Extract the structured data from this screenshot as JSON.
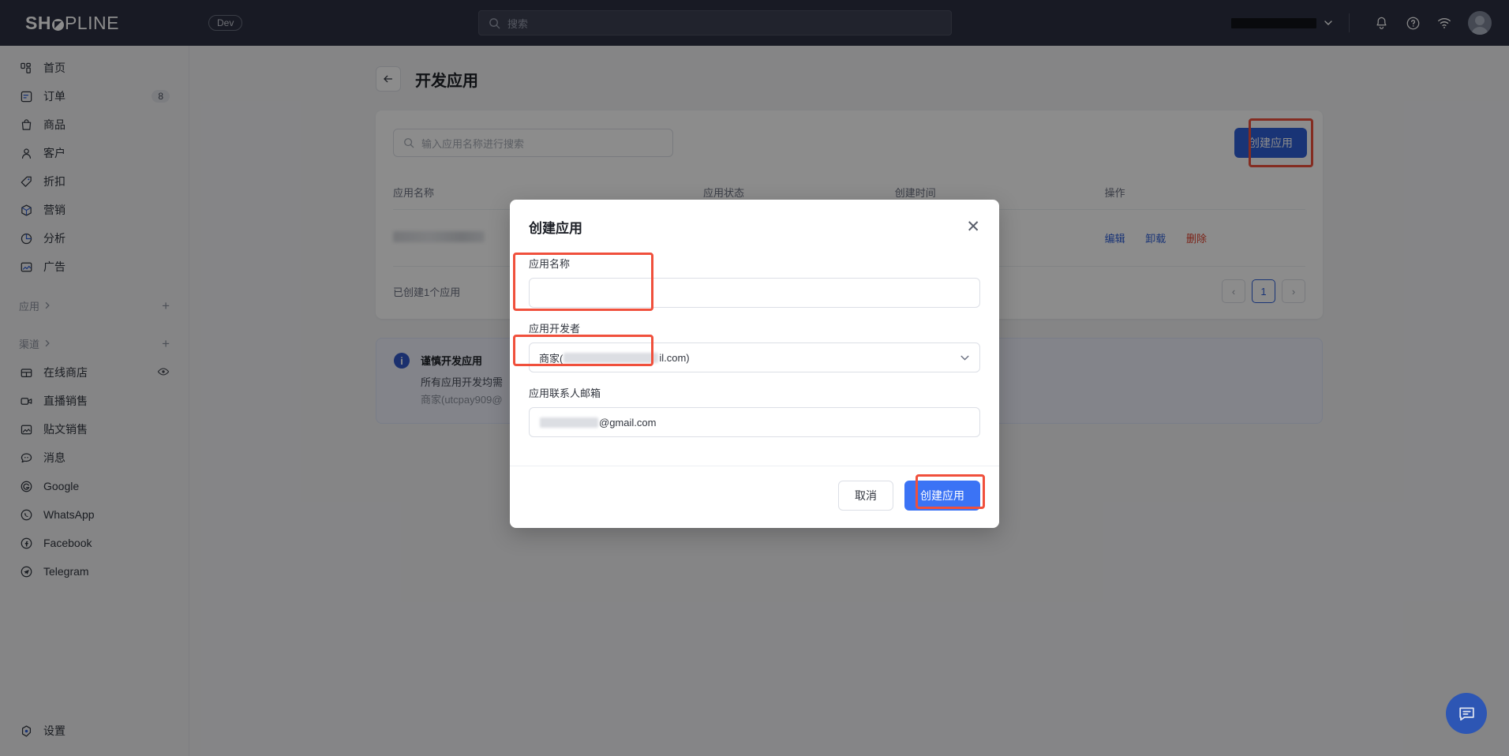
{
  "brand": {
    "name_bold": "SH",
    "name_thin": "PLINE",
    "accent": "#2f5fd8",
    "danger": "#e0412d"
  },
  "topbar": {
    "env_badge": "Dev",
    "search_placeholder": "搜索",
    "store_name": "",
    "icons": {
      "bell": "bell-icon",
      "help": "help-icon",
      "wifi": "wifi-icon",
      "avatar": "avatar"
    }
  },
  "sidebar": {
    "items": [
      {
        "label": "首页",
        "badge": ""
      },
      {
        "label": "订单",
        "badge": "8"
      },
      {
        "label": "商品",
        "badge": ""
      },
      {
        "label": "客户",
        "badge": ""
      },
      {
        "label": "折扣",
        "badge": ""
      },
      {
        "label": "营销",
        "badge": ""
      },
      {
        "label": "分析",
        "badge": ""
      },
      {
        "label": "广告",
        "badge": ""
      }
    ],
    "group_apps": "应用",
    "group_channels": "渠道",
    "channels": [
      {
        "label": "在线商店"
      },
      {
        "label": "直播销售"
      },
      {
        "label": "贴文销售"
      },
      {
        "label": "消息"
      },
      {
        "label": "Google"
      },
      {
        "label": "WhatsApp"
      },
      {
        "label": "Facebook"
      },
      {
        "label": "Telegram"
      }
    ],
    "settings": "设置"
  },
  "page": {
    "title": "开发应用",
    "search_placeholder": "输入应用名称进行搜索",
    "create_button": "创建应用",
    "table": {
      "columns": [
        "应用名称",
        "应用状态",
        "创建时间",
        "操作"
      ],
      "rows": [
        {
          "name": "",
          "status": "",
          "created": "",
          "actions": [
            "编辑",
            "卸载",
            "删除"
          ]
        }
      ]
    },
    "footer_count": "已创建1个应用",
    "pagination": {
      "prev": "‹",
      "current": "1",
      "next": "›"
    }
  },
  "notice": {
    "title": "谨慎开发应用",
    "line1": "所有应用开发均需",
    "line2": "商家(utcpay909@"
  },
  "modal": {
    "title": "创建应用",
    "close": "✕",
    "app_name": {
      "label": "应用名称",
      "value": "",
      "placeholder": ""
    },
    "developer": {
      "label": "应用开发者",
      "value_prefix": "商家(",
      "value_suffix": "il.com)"
    },
    "contact_email": {
      "label": "应用联系人邮箱",
      "value_suffix": "@gmail.com"
    },
    "cancel_button": "取消",
    "submit_button": "创建应用"
  },
  "fab": {
    "name": "chat-widget"
  }
}
